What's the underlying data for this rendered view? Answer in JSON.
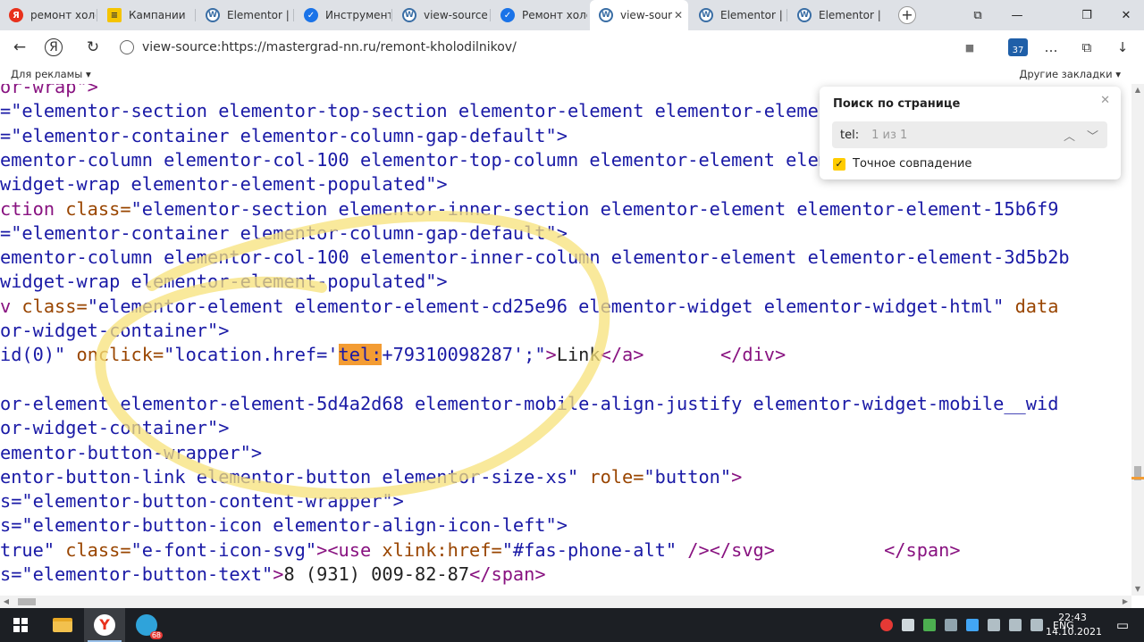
{
  "tabs": [
    {
      "title": "ремонт холо",
      "favicon": "yandex-icon"
    },
    {
      "title": "Кампании",
      "favicon": "campaign-icon"
    },
    {
      "title": "Elementor |",
      "favicon": "wordpress-icon"
    },
    {
      "title": "Инструмент",
      "favicon": "check-icon"
    },
    {
      "title": "view-source",
      "favicon": "wordpress-icon"
    },
    {
      "title": "Ремонт холо",
      "favicon": "check-icon"
    },
    {
      "title": "view-sour",
      "favicon": "wordpress-icon",
      "close": "✕"
    },
    {
      "title": "Elementor |",
      "favicon": "wordpress-icon"
    },
    {
      "title": "Elementor |",
      "favicon": "wordpress-icon"
    }
  ],
  "window_controls": {
    "bookmark": "⧉",
    "minimize": "—",
    "maximize": "❐",
    "close": "✕"
  },
  "new_tab": "+",
  "toolbar": {
    "back": "←",
    "yandex": "Я",
    "reload": "↻",
    "url": "view-source:https://mastergrad-nn.ru/remont-kholodilnikov/",
    "bookmark_icon": "■",
    "badge": "37",
    "more": "…",
    "collections": "⧉",
    "download": "↓"
  },
  "bookmarks": {
    "left": "Для рекламы ▾",
    "right": "Другие закладки ▾"
  },
  "source_lines": [
    {
      "parts": [
        {
          "t": "or-wrap\">",
          "c": "#881280"
        }
      ]
    },
    {
      "parts": [
        {
          "t": "=\"elementor-section elementor-top-section elementor-element elementor-element-",
          "c": "#1a1aa6"
        }
      ]
    },
    {
      "parts": [
        {
          "t": "=\"elementor-container elementor-column-gap-default\">",
          "c": "#1a1aa6"
        }
      ]
    },
    {
      "parts": [
        {
          "t": "ementor-column elementor-col-100 elementor-top-column elementor-element elementor-element-35",
          "c": "#1a1aa6"
        }
      ]
    },
    {
      "parts": [
        {
          "t": "widget-wrap elementor-element-populated\">",
          "c": "#1a1aa6"
        }
      ]
    },
    {
      "parts": [
        {
          "t": "ction ",
          "c": "#881280"
        },
        {
          "t": "class=",
          "c": "#994500"
        },
        {
          "t": "\"elementor-section elementor-inner-section elementor-element elementor-element-15b6f9",
          "c": "#1a1aa6"
        }
      ]
    },
    {
      "parts": [
        {
          "t": "=\"elementor-container elementor-column-gap-default\">",
          "c": "#1a1aa6"
        }
      ]
    },
    {
      "parts": [
        {
          "t": "ementor-column elementor-col-100 elementor-inner-column elementor-element elementor-element-3d5b2b",
          "c": "#1a1aa6"
        }
      ]
    },
    {
      "parts": [
        {
          "t": "widget-wrap elementor-element-populated\">",
          "c": "#1a1aa6"
        }
      ]
    },
    {
      "parts": [
        {
          "t": "v ",
          "c": "#881280"
        },
        {
          "t": "class=",
          "c": "#994500"
        },
        {
          "t": "\"elementor-element elementor-element-cd25e96 elementor-widget elementor-widget-html\" ",
          "c": "#1a1aa6"
        },
        {
          "t": "data",
          "c": "#994500"
        }
      ]
    },
    {
      "parts": [
        {
          "t": "or-widget-container\">",
          "c": "#1a1aa6"
        }
      ]
    },
    {
      "parts": [
        {
          "t": "id(0)\" ",
          "c": "#1a1aa6"
        },
        {
          "t": "onclick=",
          "c": "#994500"
        },
        {
          "t": "\"location.href='",
          "c": "#1a1aa6"
        },
        {
          "t": "tel:",
          "c": "#1a1aa6",
          "hl": true
        },
        {
          "t": "+79310098287';\"",
          "c": "#1a1aa6"
        },
        {
          "t": ">",
          "c": "#881280"
        },
        {
          "t": "Link",
          "c": "#222222"
        },
        {
          "t": "</a>",
          "c": "#881280"
        },
        {
          "t": "       ",
          "c": "#222222"
        },
        {
          "t": "</div>",
          "c": "#881280"
        }
      ]
    },
    {
      "parts": [
        {
          "t": "",
          "c": "#222222"
        }
      ]
    },
    {
      "parts": [
        {
          "t": "or-element elementor-element-5d4a2d68 elementor-mobile-align-justify elementor-widget-mobile__wid",
          "c": "#1a1aa6"
        }
      ]
    },
    {
      "parts": [
        {
          "t": "or-widget-container\">",
          "c": "#1a1aa6"
        }
      ]
    },
    {
      "parts": [
        {
          "t": "ementor-button-wrapper\">",
          "c": "#1a1aa6"
        }
      ]
    },
    {
      "parts": [
        {
          "t": "entor-button-link elementor-button elementor-size-xs\" ",
          "c": "#1a1aa6"
        },
        {
          "t": "role=",
          "c": "#994500"
        },
        {
          "t": "\"button\"",
          "c": "#1a1aa6"
        },
        {
          "t": ">",
          "c": "#881280"
        }
      ]
    },
    {
      "parts": [
        {
          "t": "s=\"elementor-button-content-wrapper\">",
          "c": "#1a1aa6"
        }
      ]
    },
    {
      "parts": [
        {
          "t": "s=\"elementor-button-icon elementor-align-icon-left\">",
          "c": "#1a1aa6"
        }
      ]
    },
    {
      "parts": [
        {
          "t": "true\" ",
          "c": "#1a1aa6"
        },
        {
          "t": "class=",
          "c": "#994500"
        },
        {
          "t": "\"e-font-icon-svg\"",
          "c": "#1a1aa6"
        },
        {
          "t": "><use ",
          "c": "#881280"
        },
        {
          "t": "xlink:href=",
          "c": "#994500"
        },
        {
          "t": "\"#fas-phone-alt\" ",
          "c": "#1a1aa6"
        },
        {
          "t": "/></svg>",
          "c": "#881280"
        },
        {
          "t": "          ",
          "c": "#222222"
        },
        {
          "t": "</span>",
          "c": "#881280"
        }
      ]
    },
    {
      "parts": [
        {
          "t": "s=\"elementor-button-text\"",
          "c": "#1a1aa6"
        },
        {
          "t": ">",
          "c": "#881280"
        },
        {
          "t": "8 (931) 009-82-87",
          "c": "#222222"
        },
        {
          "t": "</span>",
          "c": "#881280"
        }
      ]
    }
  ],
  "find_panel": {
    "title": "Поиск по странице",
    "close": "✕",
    "query": "tel:",
    "count": "1 из 1",
    "prev": "︿",
    "next": "﹀",
    "checkbox_mark": "✓",
    "checkbox_label": "Точное совпадение"
  },
  "taskbar": {
    "lang": "ENG",
    "time": "22:43",
    "date": "14.10.2021",
    "telegram_badge": "68"
  },
  "colors": {
    "tag": "#881280",
    "attr": "#994500",
    "value": "#1a1aa6",
    "highlight": "#f39c33",
    "circle": "#f7e27a"
  }
}
